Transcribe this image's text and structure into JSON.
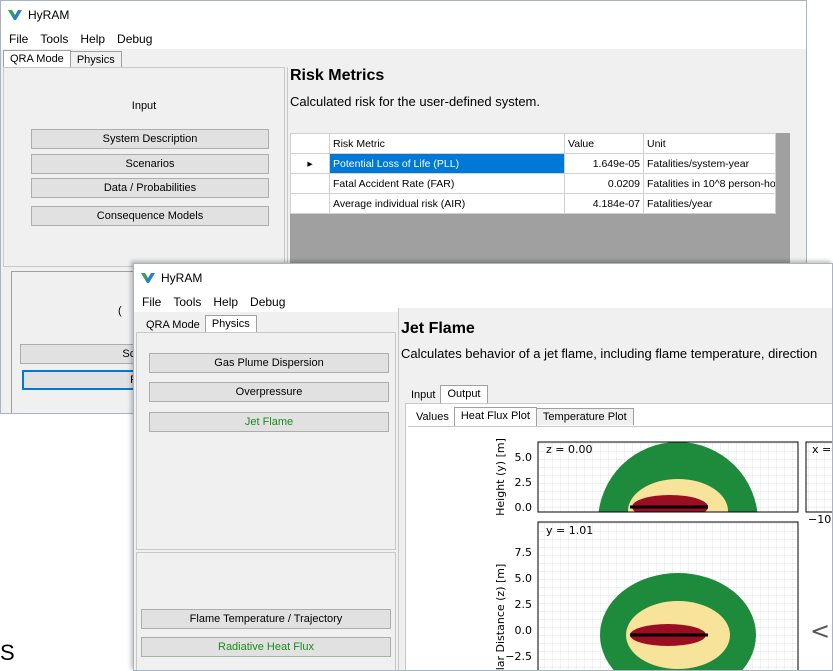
{
  "app": {
    "title": "HyRAM"
  },
  "menu": [
    "File",
    "Tools",
    "Help",
    "Debug"
  ],
  "mode_tabs": [
    "QRA Mode",
    "Physics"
  ],
  "window1": {
    "left_header": "Input",
    "buttons": [
      "System Description",
      "Scenarios",
      "Data / Probabilities",
      "Consequence Models"
    ],
    "lower_buttons": [
      "Scer",
      "Ris"
    ],
    "lower_glyph": "(",
    "title": "Risk Metrics",
    "subtitle": "Calculated risk for the user-defined system.",
    "table": {
      "headers": [
        "Risk Metric",
        "Value",
        "Unit"
      ],
      "rows": [
        {
          "metric": "Potential Loss of Life (PLL)",
          "value": "1.649e-05",
          "unit": "Fatalities/system-year"
        },
        {
          "metric": "Fatal Accident Rate (FAR)",
          "value": "0.0209",
          "unit": "Fatalities in 10^8 person-ho..."
        },
        {
          "metric": "Average individual risk (AIR)",
          "value": "4.184e-07",
          "unit": "Fatalities/year"
        }
      ]
    }
  },
  "window2": {
    "buttons": [
      "Gas Plume Dispersion",
      "Overpressure",
      "Jet Flame"
    ],
    "lower_buttons": [
      "Flame Temperature / Trajectory",
      "Radiative Heat Flux"
    ],
    "title": "Jet Flame",
    "subtitle": "Calculates behavior of a jet flame, including flame temperature, direction",
    "io_tabs": [
      "Input",
      "Output"
    ],
    "output_tabs": [
      "Values",
      "Heat Flux Plot",
      "Temperature Plot"
    ],
    "plot": {
      "top_label": "z = 0.00",
      "top_right_label": "x =",
      "bottom_label": "y = 1.01",
      "ylabel_top": "Height (y) [m]",
      "ylabel_bottom": "lar Distance (z) [m]",
      "top_ticks": [
        "5.0",
        "2.5",
        "0.0"
      ],
      "bottom_ticks": [
        "7.5",
        "5.0",
        "2.5",
        "0.0",
        "−2.5"
      ],
      "right_tick": "−10",
      "colors": {
        "outer": "#1e8a3c",
        "middle": "#f7e39a",
        "inner": "#9b0e22",
        "line": "#000000"
      },
      "chevron": "<"
    }
  },
  "edge_glyph": "S"
}
